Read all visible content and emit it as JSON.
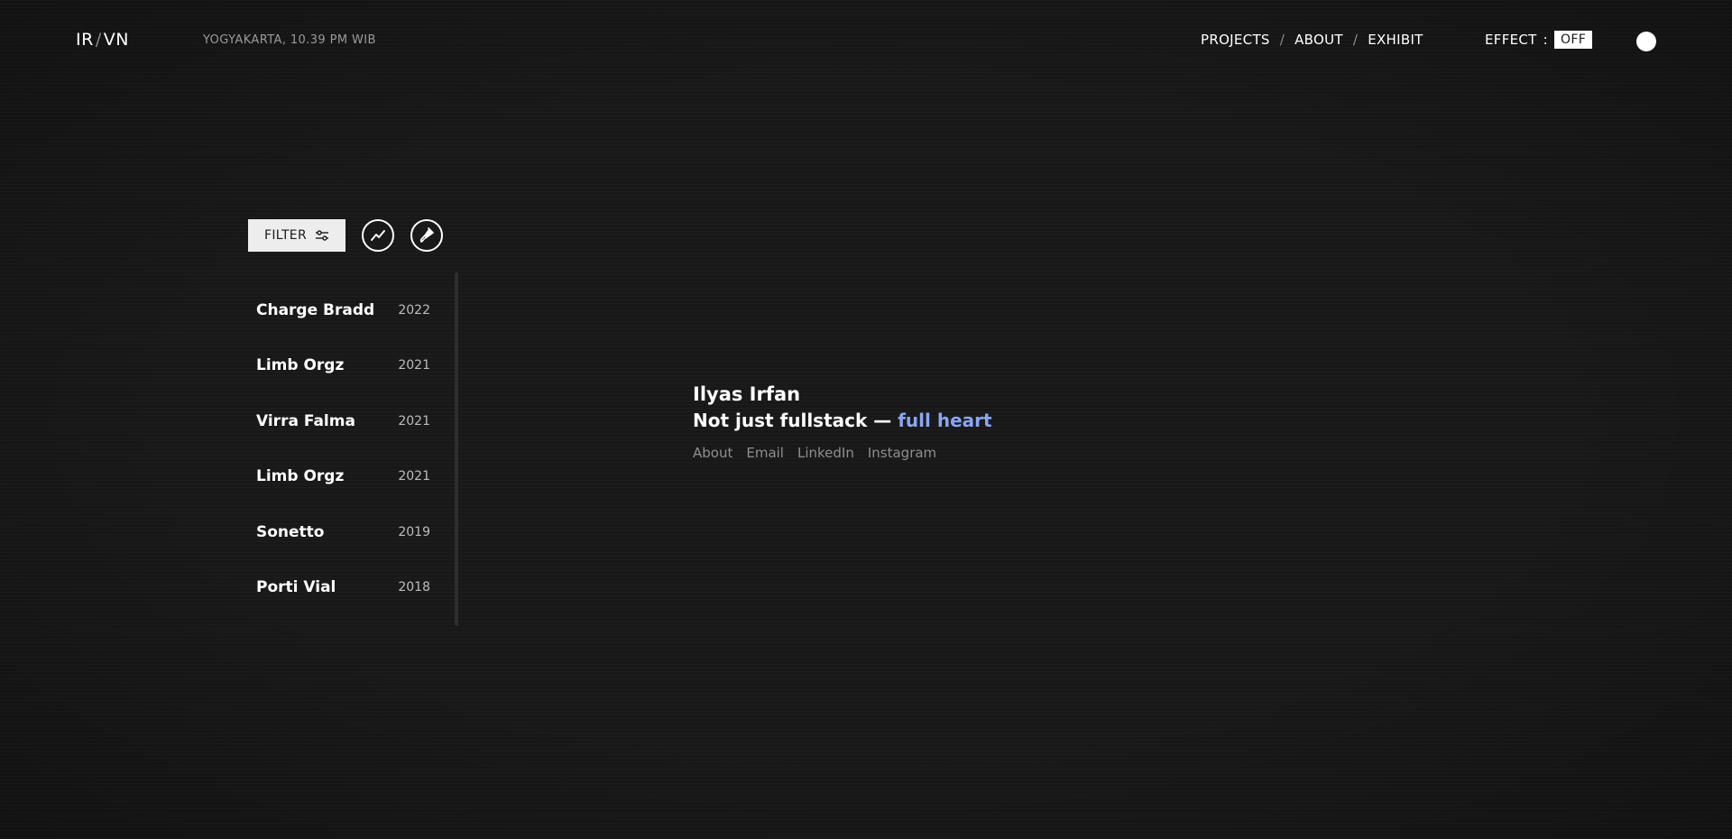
{
  "header": {
    "logo_left": "IR",
    "logo_sep": "/",
    "logo_right": "VN",
    "location": "YOGYAKARTA, 10.39 PM WIB",
    "nav": {
      "projects": "PROJECTS",
      "about": "ABOUT",
      "exhibit": "EXHIBIT",
      "separator": "/"
    },
    "effect": {
      "label": "EFFECT",
      "colon": ":",
      "state": "OFF"
    }
  },
  "filter": {
    "label": "FILTER",
    "icon": "sliders-icon",
    "trend_icon": "trend-line-icon",
    "art_icon": "paint-brush-icon"
  },
  "projects": [
    {
      "name": "Charge Bradd",
      "year": "2022"
    },
    {
      "name": "Limb Orgz",
      "year": "2021"
    },
    {
      "name": "Virra Falma",
      "year": "2021"
    },
    {
      "name": "Limb Orgz",
      "year": "2021"
    },
    {
      "name": "Sonetto",
      "year": "2019"
    },
    {
      "name": "Porti Vial",
      "year": "2018"
    }
  ],
  "intro": {
    "name": "Ilyas Irfan",
    "tagline_main": "Not just fullstack —",
    "tagline_accent": "full heart",
    "links": {
      "about": "About",
      "email": "Email",
      "linkedin": "LinkedIn",
      "instagram": "Instagram"
    }
  },
  "colors": {
    "background": "#181818",
    "accent": "#8aa6f0",
    "muted": "#8f8f8f"
  }
}
